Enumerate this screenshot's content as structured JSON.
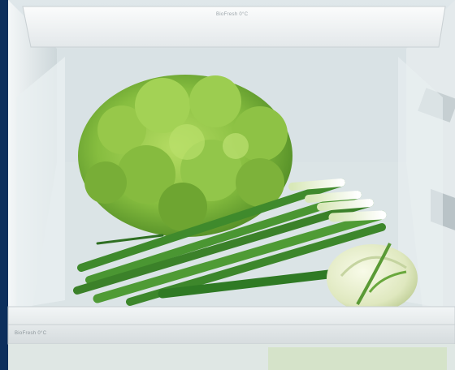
{
  "image": {
    "subject": "vegetables-in-refrigerator-crisper-drawer",
    "items": [
      "lettuce",
      "spring-onions",
      "fennel-bulb"
    ]
  },
  "labels": {
    "top_shelf": "BioFresh 0°C",
    "drawer_front": "BioFresh 0°C"
  },
  "colors": {
    "frame": "#0d2f5c",
    "drawer_glass": "#e7eef0",
    "lettuce": "#7fb63a",
    "onion_green": "#3f8a2c",
    "onion_white": "#eef2dc",
    "fennel": "#dfe8c4"
  }
}
